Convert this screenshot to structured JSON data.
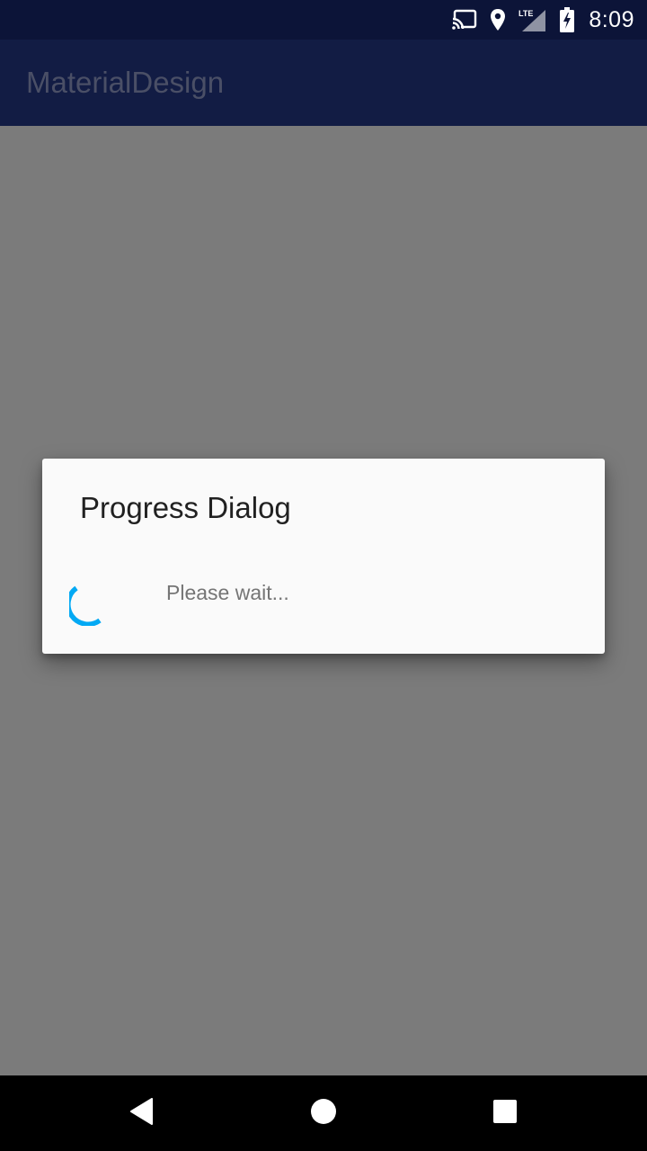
{
  "status_bar": {
    "time": "8:09",
    "network_label": "LTE",
    "icons": [
      "cast-icon",
      "location-pin-icon",
      "lte-signal-icon",
      "battery-charging-icon"
    ]
  },
  "app_bar": {
    "title": "MaterialDesign"
  },
  "dialog": {
    "title": "Progress Dialog",
    "message": "Please wait...",
    "spinner_color": "#03A9F4"
  },
  "nav_bar": {
    "buttons": [
      "back-icon",
      "home-icon",
      "recents-icon"
    ]
  },
  "colors": {
    "status_bar": "#0c1438",
    "app_bar": "#121c44",
    "scrim": "#7b7b7b",
    "dialog_bg": "#fafafa",
    "accent": "#03A9F4"
  }
}
